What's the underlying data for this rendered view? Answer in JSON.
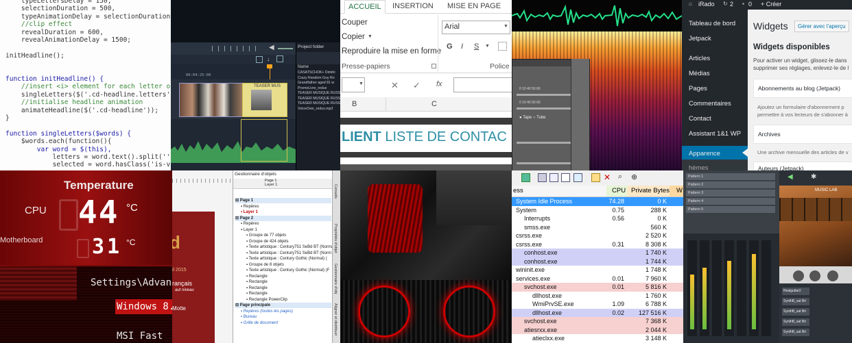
{
  "code_editor": {
    "lines": [
      "    typeLettersDelay = 150,",
      "    selectionDuration = 500,",
      "    typeAnimationDelay = selectionDuration + 800,",
      "    //clip effect",
      "    revealDuration = 600,",
      "    revealAnimationDelay = 1500;",
      "",
      "initHeadline();",
      "",
      "",
      "function initHeadline() {",
      "    //insert <i> element for each letter of a c",
      "    singleLetters($('.cd-headline.letters').fin",
      "    //initialise headline animation",
      "    animateHeadline($('.cd-headline'));",
      "}",
      "",
      "function singleLetters($words) {",
      "    $words.each(function(){",
      "        var word = $(this),",
      "            letters = word.text().split(''),",
      "            selected = word.hasClass('is-visibl"
    ]
  },
  "video_editor": {
    "panel_title": "Project folder",
    "column_name": "Name",
    "files": [
      "CASATSCHOK+ Dimitri",
      "Crazy Random Guy Ro",
      "Grandfather aged 81 w",
      "PromoLivre_redux",
      "TEASER MUSIQUE RUSS",
      "TEASER MUSIQUE RUSS",
      "TEASER MUSIQUE RUSS",
      "VoiceOver_redux.mp3"
    ],
    "timecode": "00:04:25:00",
    "clip_label": "TEASER MUS"
  },
  "excel": {
    "tabs": [
      "ACCUEIL",
      "INSERTION",
      "MISE EN PAGE"
    ],
    "clipboard": [
      "Couper",
      "Copier",
      "Reproduire la mise en forme"
    ],
    "clipboard_group": "Presse-papiers",
    "font_name": "Arial",
    "font_group": "Police",
    "format_buttons": [
      "G",
      "I",
      "S"
    ],
    "fx": "fx",
    "columns": [
      "B",
      "C"
    ],
    "heading_bold": "LIENT",
    "heading_rest": " LISTE DE CONTAC"
  },
  "audio_editor": {
    "radio_options": [
      "Tape",
      "Tube"
    ]
  },
  "wordpress": {
    "site_name": "iRado",
    "comments_count": "2",
    "notif_count": "0",
    "new_label": "+ Créer",
    "menu": [
      "Tableau de bord",
      "Jetpack",
      "Articles",
      "Médias",
      "Pages",
      "Commentaires",
      "Contact",
      "Assistant 1&1 WP",
      "Apparence",
      "hèmes"
    ],
    "page_title": "Widgets",
    "manage_link": "Gérer avec l'aperçu",
    "available_heading": "Widgets disponibles",
    "intro": [
      "Pour activer un widget, glissez-le dans",
      "supprimer ses réglages, enlevez-le de l"
    ],
    "widget1_title": "Abonnements au blog (Jetpack)",
    "widget1_desc": [
      "Ajoutez un formulaire d'abonnement p",
      "permettre à vos lecteurs de s'abonner à"
    ],
    "widget2_title": "Archives",
    "widget2_desc": "Une archive mensuelle des articles de v",
    "widget3_title": "Auteurs (Jetpack)"
  },
  "temperature": {
    "title": "Temperature",
    "cpu_label": "CPU",
    "cpu_value": "44",
    "cpu_unit": "°C",
    "mb_label": "Motherboard",
    "mb_value": "31",
    "mb_unit": "°C",
    "bios_lines": [
      "Settings\\Advan",
      "Windows 8.",
      "MSI Fast"
    ]
  },
  "object_manager": {
    "title": "Gestionnaire d'objets",
    "header_page": "Page 1",
    "header_layer": "Layer 1",
    "rows": [
      {
        "indent": 0,
        "text": "Page 1",
        "style": "page"
      },
      {
        "indent": 1,
        "text": "Repères",
        "style": "normal"
      },
      {
        "indent": 1,
        "text": "Layer 1",
        "style": "red"
      },
      {
        "indent": 0,
        "text": "Page 2",
        "style": "page"
      },
      {
        "indent": 1,
        "text": "Repères",
        "style": "normal"
      },
      {
        "indent": 1,
        "text": "Layer 1",
        "style": "normal"
      },
      {
        "indent": 2,
        "text": "Groupe de 77 objets",
        "style": "normal"
      },
      {
        "indent": 2,
        "text": "Groupe de 424 objets",
        "style": "normal"
      },
      {
        "indent": 2,
        "text": "Texte artistique : Century751 SeBd BT (Norma",
        "style": "normal"
      },
      {
        "indent": 2,
        "text": "Texte artistique : Century751 SeBd BT (Norm",
        "style": "normal"
      },
      {
        "indent": 2,
        "text": "Texte artistique : Century Gothic (Normal) (",
        "style": "normal"
      },
      {
        "indent": 2,
        "text": "Groupe de 8 objets",
        "style": "normal"
      },
      {
        "indent": 2,
        "text": "Texte artistique : Century Gothic (Normal) (F",
        "style": "normal"
      },
      {
        "indent": 2,
        "text": "Rectangle",
        "style": "normal"
      },
      {
        "indent": 2,
        "text": "Rectangle",
        "style": "normal"
      },
      {
        "indent": 2,
        "text": "Rectangle",
        "style": "normal"
      },
      {
        "indent": 2,
        "text": "Rectangle",
        "style": "normal"
      },
      {
        "indent": 2,
        "text": "Rectangle PowerClip",
        "style": "normal"
      },
      {
        "indent": 0,
        "text": "Page principale",
        "style": "page"
      },
      {
        "indent": 1,
        "text": "Repères (toutes les pages)",
        "style": "blue"
      },
      {
        "indent": 1,
        "text": "Bureau",
        "style": "blue"
      },
      {
        "indent": 1,
        "text": "Grille de document",
        "style": "blue"
      }
    ],
    "side_tabs": [
      "Conseils",
      "Propriétés d'objet",
      "Gestionnaire d'obj",
      "Aligner et distribuer"
    ],
    "book_year": "il 2015",
    "book_lines": [
      "rançais",
      "aut niveau",
      "Motte"
    ],
    "book_letter": "d"
  },
  "process_explorer": {
    "col_process": "ess",
    "col_cpu": "CPU",
    "col_private": "Private Bytes",
    "col_extra": "W",
    "rows": [
      {
        "name": "System Idle Process",
        "cpu": "74.28",
        "bytes": "0 K",
        "indent": 0,
        "color": "#9cc3f5",
        "sel": true
      },
      {
        "name": "System",
        "cpu": "0.75",
        "bytes": "288 K",
        "indent": 0,
        "color": "",
        "sel": false
      },
      {
        "name": "Interrupts",
        "cpu": "0.56",
        "bytes": "0 K",
        "indent": 1,
        "color": "",
        "sel": false
      },
      {
        "name": "smss.exe",
        "cpu": "",
        "bytes": "560 K",
        "indent": 1,
        "color": "",
        "sel": false
      },
      {
        "name": "csrss.exe",
        "cpu": "",
        "bytes": "2 520 K",
        "indent": 0,
        "color": "",
        "sel": false
      },
      {
        "name": "csrss.exe",
        "cpu": "0.31",
        "bytes": "8 308 K",
        "indent": 0,
        "color": "",
        "sel": false
      },
      {
        "name": "conhost.exe",
        "cpu": "",
        "bytes": "1 740 K",
        "indent": 1,
        "color": "#d0d0f7",
        "sel": false
      },
      {
        "name": "conhost.exe",
        "cpu": "",
        "bytes": "1 744 K",
        "indent": 1,
        "color": "#d0d0f7",
        "sel": false
      },
      {
        "name": "wininit.exe",
        "cpu": "",
        "bytes": "1 748 K",
        "indent": 0,
        "color": "",
        "sel": false
      },
      {
        "name": "services.exe",
        "cpu": "0.01",
        "bytes": "7 960 K",
        "indent": 0,
        "color": "",
        "sel": false
      },
      {
        "name": "svchost.exe",
        "cpu": "0.01",
        "bytes": "5 816 K",
        "indent": 1,
        "color": "#f7d0d0",
        "sel": false
      },
      {
        "name": "dllhost.exe",
        "cpu": "",
        "bytes": "1 760 K",
        "indent": 2,
        "color": "",
        "sel": false
      },
      {
        "name": "WmiPrvSE.exe",
        "cpu": "1.09",
        "bytes": "6 788 K",
        "indent": 2,
        "color": "",
        "sel": false
      },
      {
        "name": "dllhost.exe",
        "cpu": "0.02",
        "bytes": "127 516 K",
        "indent": 2,
        "color": "#d0d0f7",
        "sel": false
      },
      {
        "name": "svchost.exe",
        "cpu": "",
        "bytes": "7 368 K",
        "indent": 1,
        "color": "#f7d0d0",
        "sel": false
      },
      {
        "name": "atiesrxx.exe",
        "cpu": "",
        "bytes": "2 044 K",
        "indent": 1,
        "color": "#f7d0d0",
        "sel": false
      },
      {
        "name": "atieclxx.exe",
        "cpu": "",
        "bytes": "3 148 K",
        "indent": 2,
        "color": "",
        "sel": false
      }
    ]
  },
  "music_daw": {
    "brand": "MUSIC LAB",
    "patterns": [
      "Pattern 1",
      "Pattern 2",
      "Pattern 3",
      "Pattern 4",
      "Pattern 5"
    ],
    "pattern_labels": [
      "Realguitar2",
      "SynthB_sat Bri",
      "SynthB_sat Bri",
      "SynthB_sat Bri",
      "SynthB_sat Bri"
    ]
  }
}
